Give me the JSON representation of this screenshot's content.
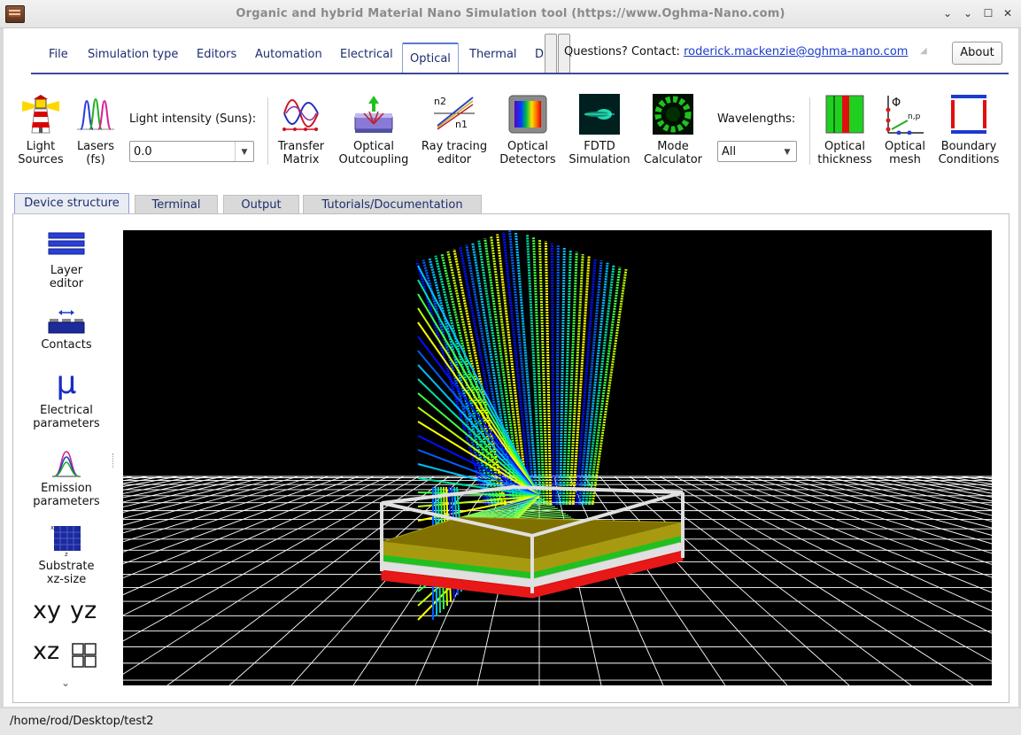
{
  "window": {
    "title": "Organic and hybrid Material Nano Simulation tool (https://www.Oghma-Nano.com)"
  },
  "menu": {
    "tabs": [
      {
        "label": "File"
      },
      {
        "label": "Simulation type"
      },
      {
        "label": "Editors"
      },
      {
        "label": "Automation"
      },
      {
        "label": "Electrical"
      },
      {
        "label": "Optical"
      },
      {
        "label": "Thermal"
      },
      {
        "label": "D"
      }
    ],
    "active_tab": "Optical",
    "contact_prefix": "Questions? Contact:",
    "contact_email": "roderick.mackenzie@oghma-nano.com",
    "about_label": "About"
  },
  "ribbon": {
    "light_sources": {
      "line1": "Light",
      "line2": "Sources",
      "icon": "lighthouse-icon"
    },
    "lasers": {
      "line1": "Lasers",
      "line2": "(fs)",
      "icon": "laser-pulses-icon"
    },
    "light_intensity_label": "Light intensity (Suns):",
    "light_intensity_value": "0.0",
    "transfer_matrix": {
      "line1": "Transfer",
      "line2": "Matrix",
      "icon": "transfer-matrix-icon"
    },
    "optical_outcoupling": {
      "line1": "Optical",
      "line2": "Outcoupling",
      "icon": "outcoupling-icon"
    },
    "ray_tracing": {
      "line1": "Ray tracing",
      "line2": "editor",
      "icon": "ray-tracing-icon",
      "n2": "n2",
      "n1": "n1"
    },
    "optical_detectors": {
      "line1": "Optical",
      "line2": "Detectors",
      "icon": "detector-icon"
    },
    "fdtd": {
      "line1": "FDTD",
      "line2": "Simulation",
      "icon": "fdtd-icon"
    },
    "mode_calculator": {
      "line1": "Mode",
      "line2": "Calculator",
      "icon": "mode-icon"
    },
    "wavelengths_label": "Wavelengths:",
    "wavelengths_value": "All",
    "optical_thickness": {
      "line1": "Optical",
      "line2": "thickness",
      "icon": "optical-thickness-icon"
    },
    "optical_mesh": {
      "line1": "Optical",
      "line2": "mesh",
      "icon": "optical-mesh-icon",
      "phi": "Φ",
      "sub": "n,p"
    },
    "boundary_conditions": {
      "line1": "Boundary",
      "line2": "Conditions",
      "icon": "boundary-icon"
    }
  },
  "subtabs": [
    {
      "label": "Device structure"
    },
    {
      "label": "Terminal"
    },
    {
      "label": "Output"
    },
    {
      "label": "Tutorials/Documentation"
    }
  ],
  "sidebar": {
    "layer_editor": {
      "line1": "Layer",
      "line2": "editor"
    },
    "contacts": {
      "line1": "Contacts"
    },
    "electrical": {
      "line1": "Electrical",
      "line2": "parameters",
      "glyph": "μ"
    },
    "emission": {
      "line1": "Emission",
      "line2": "parameters"
    },
    "substrate": {
      "line1": "Substrate",
      "line2": "xz-size"
    },
    "views": {
      "xy": "xy",
      "yz": "yz",
      "xz": "xz"
    },
    "more": "⌄"
  },
  "colors": {
    "accent": "#3b4a9a",
    "tab_text": "#1e2d6e",
    "link": "#1a3cc8",
    "viewport_bg": "#000000",
    "layer_gold": "#9a8a00",
    "layer_green": "#1aa01a",
    "layer_red": "#e01010",
    "layer_white": "#d8d8d8"
  },
  "status": {
    "path": "/home/rod/Desktop/test2"
  }
}
